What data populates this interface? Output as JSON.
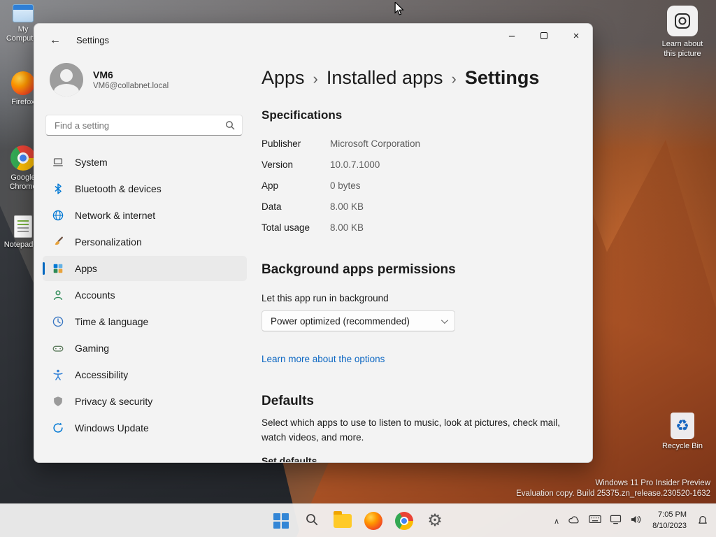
{
  "colors": {
    "accent": "#0067c0",
    "link": "#0b66c2",
    "window_bg": "#f3f3f3",
    "taskbar_bg": "#f3f3f3",
    "selected_nav_bg": "#eaeaea"
  },
  "icons": {
    "back": "←",
    "minimize": "–",
    "close": "×",
    "crumb_sep": "›",
    "tray_chevron": "∧",
    "gear": "⚙",
    "recycle": "♻"
  },
  "desktop": {
    "icons": [
      {
        "label": "My Computer"
      },
      {
        "label": "Firefox"
      },
      {
        "label": "Google Chrome"
      },
      {
        "label": "Notepad++"
      }
    ],
    "learn_about_label": "Learn about this picture",
    "recycle_bin_label": "Recycle Bin",
    "watermark": {
      "line1": "Windows 11 Pro Insider Preview",
      "line2": "Evaluation copy. Build 25375.zn_release.230520-1632"
    }
  },
  "window": {
    "title": "Settings",
    "user": {
      "name": "VM6",
      "email": "VM6@collabnet.local"
    },
    "search_placeholder": "Find a setting",
    "nav": [
      {
        "label": "System"
      },
      {
        "label": "Bluetooth & devices"
      },
      {
        "label": "Network & internet"
      },
      {
        "label": "Personalization"
      },
      {
        "label": "Apps",
        "selected": true
      },
      {
        "label": "Accounts"
      },
      {
        "label": "Time & language"
      },
      {
        "label": "Gaming"
      },
      {
        "label": "Accessibility"
      },
      {
        "label": "Privacy & security"
      },
      {
        "label": "Windows Update"
      }
    ],
    "breadcrumb": {
      "items": [
        "Apps",
        "Installed apps",
        "Settings"
      ]
    },
    "specs": {
      "title": "Specifications",
      "rows": [
        {
          "label": "Publisher",
          "value": "Microsoft Corporation"
        },
        {
          "label": "Version",
          "value": "10.0.7.1000"
        },
        {
          "label": "App",
          "value": "0 bytes"
        },
        {
          "label": "Data",
          "value": "8.00 KB"
        },
        {
          "label": "Total usage",
          "value": "8.00 KB"
        }
      ]
    },
    "background_permissions": {
      "title": "Background apps permissions",
      "label": "Let this app run in background",
      "dropdown_value": "Power optimized (recommended)",
      "link": "Learn more about the options"
    },
    "defaults": {
      "title": "Defaults",
      "description": "Select which apps to use to listen to music, look at pictures, check mail, watch videos, and more.",
      "partial": "Set defaults"
    }
  },
  "taskbar": {
    "icons": [
      "start",
      "search",
      "file-explorer",
      "firefox",
      "chrome",
      "settings"
    ],
    "tray_icons": [
      "tray-chevron",
      "onedrive",
      "touch-keyboard",
      "cast-display",
      "volume"
    ],
    "time": "7:05 PM",
    "date": "8/10/2023",
    "notification": "notification-bell"
  }
}
